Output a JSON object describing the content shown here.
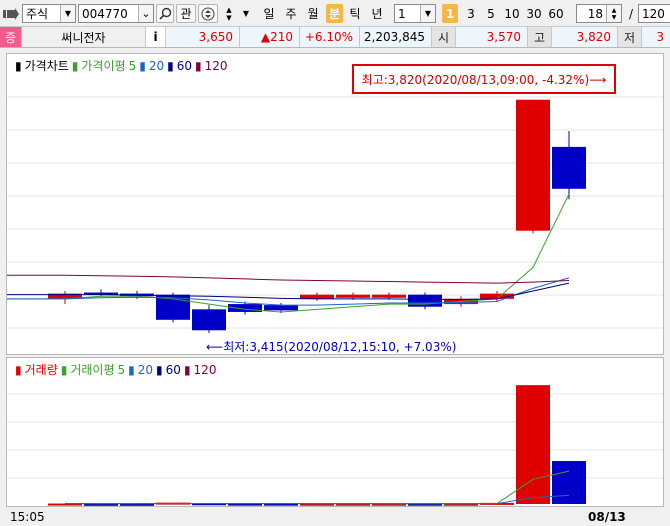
{
  "toolbar": {
    "market": "주식",
    "code": "004770",
    "btn_watch": "관",
    "periods": [
      "일",
      "주",
      "월",
      "분",
      "틱",
      "년"
    ],
    "active_period": "분",
    "interval_value": "1",
    "interval_active": "1",
    "quick_intervals": [
      "3",
      "5",
      "10",
      "30",
      "60"
    ],
    "count_value": "18",
    "slash": "/",
    "total_value": "120"
  },
  "quote": {
    "badge": "증",
    "name": "써니전자",
    "info": "i",
    "price": "3,650",
    "change": "▲210",
    "change_pct": "+6.10%",
    "volume": "2,203,845",
    "open_label": "시",
    "open": "3,570",
    "high_label": "고",
    "high": "3,820",
    "low_label": "저",
    "low_partial": "3"
  },
  "price_chart": {
    "legend": {
      "title": "가격차트",
      "ma_label": "가격이평",
      "ma": [
        "5",
        "20",
        "60",
        "120"
      ]
    },
    "annotation_high": "최고:3,820(2020/08/13,09:00, -4.32%)⟶",
    "annotation_low": "⟵최저:3,415(2020/08/12,15:10, +7.03%)"
  },
  "volume_chart": {
    "legend": {
      "title": "거래량",
      "ma_label": "거래이평",
      "ma": [
        "5",
        "20",
        "60",
        "120"
      ]
    }
  },
  "xaxis": {
    "left_label": "15:05",
    "right_label": "08/13"
  },
  "colors": {
    "up": "#e00000",
    "down": "#0000c8",
    "ma5": "#3ca02c",
    "ma20": "#1e64c8",
    "ma60": "#000080",
    "ma120": "#800040"
  },
  "chart_data": [
    {
      "type": "candlestick",
      "title": "가격차트",
      "candles": [
        {
          "open": 3440,
          "close": 3450,
          "high": 3455,
          "low": 3430,
          "dir": "up"
        },
        {
          "open": 3452,
          "close": 3448,
          "high": 3458,
          "low": 3444,
          "dir": "down"
        },
        {
          "open": 3450,
          "close": 3445,
          "high": 3455,
          "low": 3440,
          "dir": "down"
        },
        {
          "open": 3448,
          "close": 3400,
          "high": 3452,
          "low": 3395,
          "dir": "down"
        },
        {
          "open": 3420,
          "close": 3380,
          "high": 3428,
          "low": 3375,
          "dir": "down"
        },
        {
          "open": 3430,
          "close": 3415,
          "high": 3435,
          "low": 3410,
          "dir": "down"
        },
        {
          "open": 3428,
          "close": 3418,
          "high": 3432,
          "low": 3413,
          "dir": "down"
        },
        {
          "open": 3440,
          "close": 3448,
          "high": 3452,
          "low": 3436,
          "dir": "up"
        },
        {
          "open": 3442,
          "close": 3448,
          "high": 3452,
          "low": 3438,
          "dir": "up"
        },
        {
          "open": 3442,
          "close": 3448,
          "high": 3452,
          "low": 3438,
          "dir": "up"
        },
        {
          "open": 3448,
          "close": 3425,
          "high": 3452,
          "low": 3420,
          "dir": "down"
        },
        {
          "open": 3430,
          "close": 3440,
          "high": 3445,
          "low": 3425,
          "dir": "up"
        },
        {
          "open": 3440,
          "close": 3450,
          "high": 3455,
          "low": 3435,
          "dir": "up"
        },
        {
          "open": 3570,
          "close": 3820,
          "high": 3820,
          "low": 3565,
          "dir": "up"
        },
        {
          "open": 3730,
          "close": 3650,
          "high": 3760,
          "low": 3630,
          "dir": "down"
        }
      ],
      "ylim": [
        3350,
        3850
      ],
      "moving_averages": {
        "ma5": [
          3440,
          3445,
          3445,
          3440,
          3430,
          3420,
          3415,
          3420,
          3425,
          3430,
          3430,
          3435,
          3440,
          3500,
          3640
        ],
        "ma20": [
          3440,
          3442,
          3443,
          3442,
          3438,
          3432,
          3428,
          3428,
          3430,
          3432,
          3432,
          3433,
          3435,
          3460,
          3480
        ],
        "ma60": [
          3448,
          3448,
          3447,
          3446,
          3445,
          3443,
          3441,
          3440,
          3440,
          3440,
          3439,
          3439,
          3440,
          3455,
          3470
        ],
        "ma120": [
          3485,
          3484,
          3483,
          3482,
          3480,
          3478,
          3476,
          3475,
          3474,
          3473,
          3472,
          3471,
          3470,
          3472,
          3475
        ]
      }
    },
    {
      "type": "bar",
      "title": "거래량",
      "values": [
        5000,
        2000,
        2000,
        15000,
        8000,
        4000,
        4000,
        3000,
        3000,
        3000,
        3000,
        3000,
        12000,
        1300000,
        470000
      ],
      "dirs": [
        "up",
        "down",
        "down",
        "up",
        "down",
        "down",
        "down",
        "up",
        "up",
        "up",
        "down",
        "up",
        "up",
        "up",
        "down"
      ],
      "ylim": [
        0,
        1400000
      ],
      "moving_averages": {
        "ma5": [
          5000,
          4500,
          4000,
          5000,
          6000,
          6000,
          5500,
          4500,
          3800,
          3400,
          3200,
          3000,
          4800,
          270000,
          360000
        ],
        "ma20": [
          4000,
          4000,
          4000,
          4200,
          4500,
          4600,
          4500,
          4300,
          4200,
          4100,
          4000,
          3900,
          4200,
          70000,
          95000
        ]
      }
    }
  ]
}
